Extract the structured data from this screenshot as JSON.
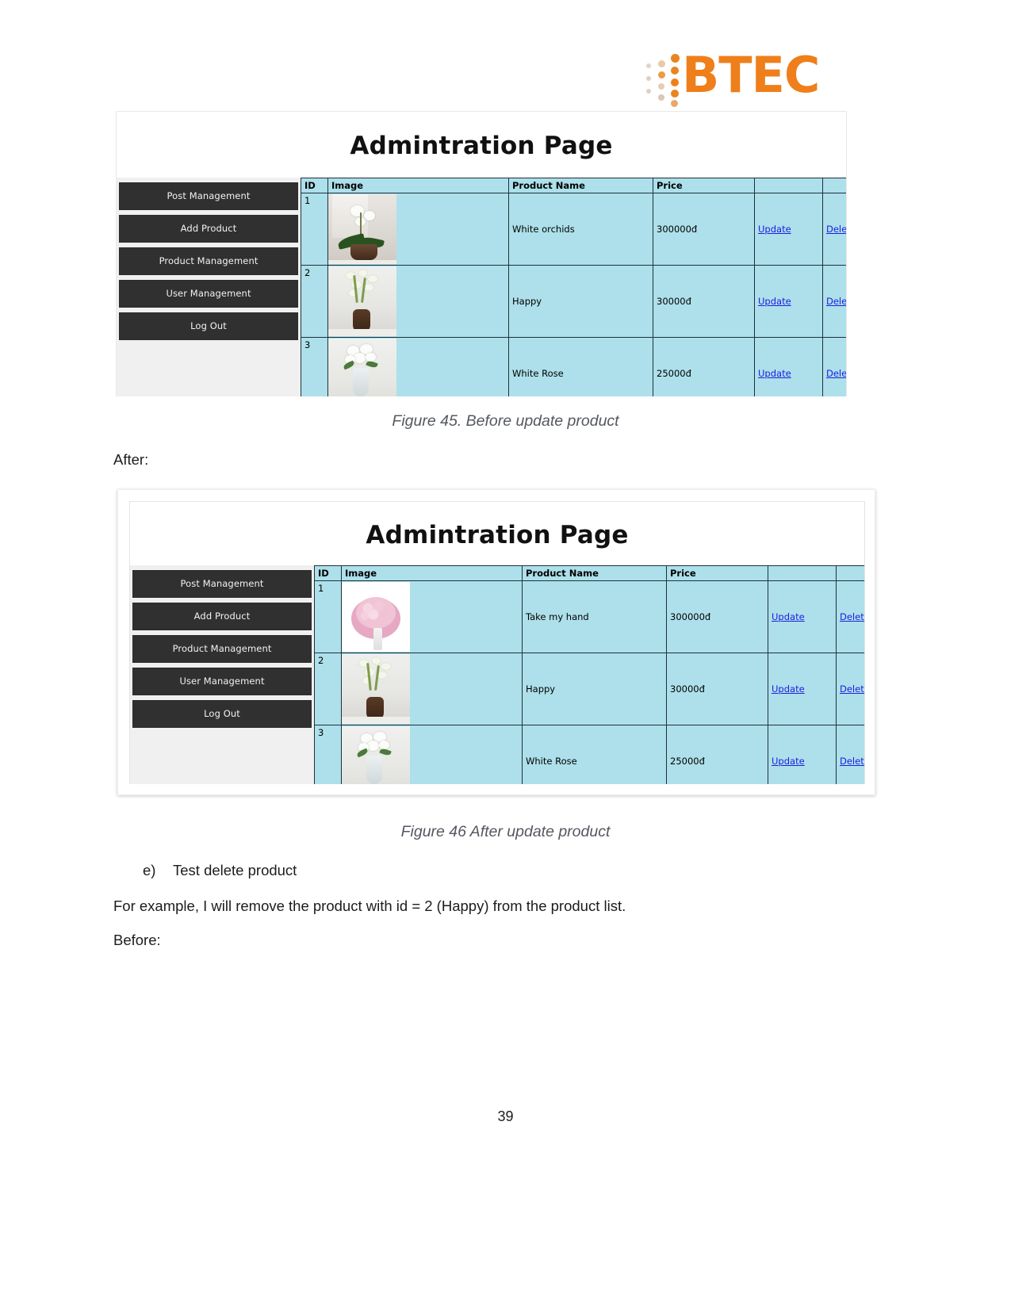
{
  "logo": {
    "text": "BTEC",
    "color": "#ef7f1a"
  },
  "figure_before": {
    "admin": {
      "title": "Admintration Page",
      "sidebar": [
        "Post Management",
        "Add Product",
        "Product Management",
        "User Management",
        "Log Out"
      ],
      "table": {
        "headers": [
          "ID",
          "Image",
          "Product Name",
          "Price",
          "",
          ""
        ],
        "rows": [
          {
            "id": "1",
            "image": "white-orchid-photo",
            "name": "White orchids",
            "price": "300000đ",
            "update": "Update",
            "delete": "Delete"
          },
          {
            "id": "2",
            "image": "gladiolus-vase-photo",
            "name": "Happy",
            "price": "30000đ",
            "update": "Update",
            "delete": "Delete"
          },
          {
            "id": "3",
            "image": "white-rose-vase-photo",
            "name": "White Rose",
            "price": "25000đ",
            "update": "Update",
            "delete": "Delete"
          }
        ]
      }
    },
    "caption": "Figure 45. Before update product"
  },
  "figure_after": {
    "admin": {
      "title": "Admintration Page",
      "sidebar": [
        "Post Management",
        "Add Product",
        "Product Management",
        "User Management",
        "Log Out"
      ],
      "table": {
        "headers": [
          "ID",
          "Image",
          "Product Name",
          "Price",
          "",
          ""
        ],
        "rows": [
          {
            "id": "1",
            "image": "pink-bouquet-photo",
            "name": "Take my hand",
            "price": "300000đ",
            "update": "Update",
            "delete": "Delete"
          },
          {
            "id": "2",
            "image": "gladiolus-vase-photo",
            "name": "Happy",
            "price": "30000đ",
            "update": "Update",
            "delete": "Delete"
          },
          {
            "id": "3",
            "image": "white-rose-vase-photo",
            "name": "White Rose",
            "price": "25000đ",
            "update": "Update",
            "delete": "Delete"
          }
        ]
      }
    },
    "caption": "Figure 46 After update product"
  },
  "body": {
    "after_label": "After:",
    "list_marker": "e)",
    "list_text": "Test delete product",
    "example_text": "For example, I will remove the product with id = 2 (Happy) from the product list.",
    "before_label": "Before:"
  },
  "page_number": "39"
}
